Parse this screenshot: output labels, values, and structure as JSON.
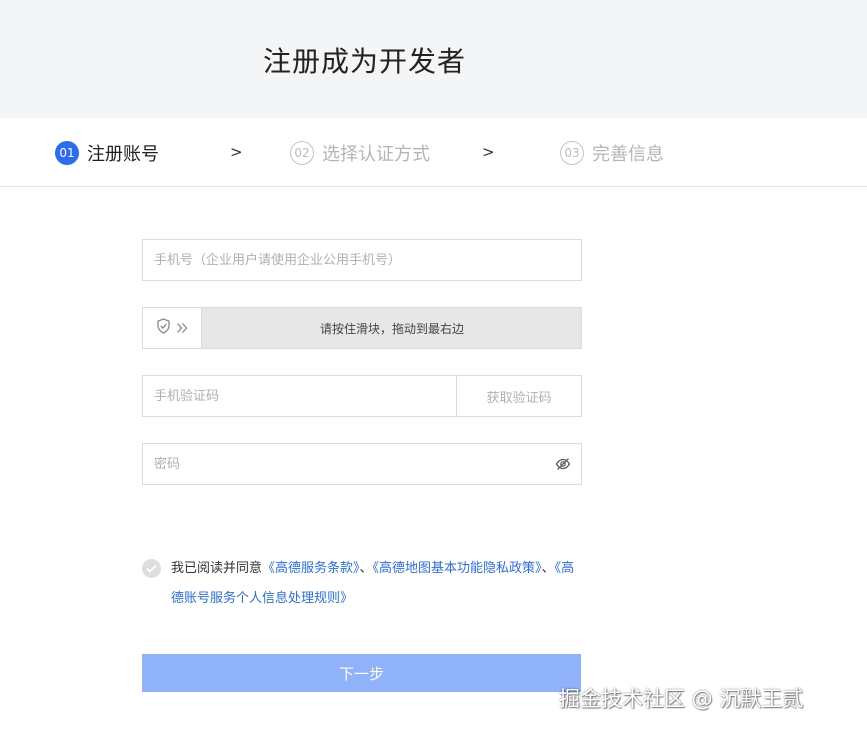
{
  "header": {
    "title": "注册成为开发者"
  },
  "steps": [
    {
      "num": "01",
      "label": "注册账号",
      "active": true
    },
    {
      "num": "02",
      "label": "选择认证方式",
      "active": false
    },
    {
      "num": "03",
      "label": "完善信息",
      "active": false
    }
  ],
  "step_arrow": ">",
  "form": {
    "phone_placeholder": "手机号（企业用户请使用企业公用手机号）",
    "slider_text": "请按住滑块，拖动到最右边",
    "code_placeholder": "手机验证码",
    "get_code_label": "获取验证码",
    "password_placeholder": "密码"
  },
  "agreement": {
    "prefix": "我已阅读并同意",
    "link1": "《高德服务条款》",
    "sep1": "、",
    "link2": "《高德地图基本功能隐私政策》",
    "sep2": "、",
    "link3": "《高德账号服务个人信息处理规则》"
  },
  "next_label": "下一步",
  "watermark": "掘金技术社区 @ 沉默王贰",
  "colors": {
    "accent": "#2a6cf6",
    "button_disabled": "#8fb2fa",
    "header_bg": "#f4f5f7"
  },
  "icons": {
    "slider": "shield-check-icon",
    "slider_arrows": "double-chevron-right-icon",
    "password_toggle": "eye-off-icon",
    "agree": "check-circle-icon"
  }
}
